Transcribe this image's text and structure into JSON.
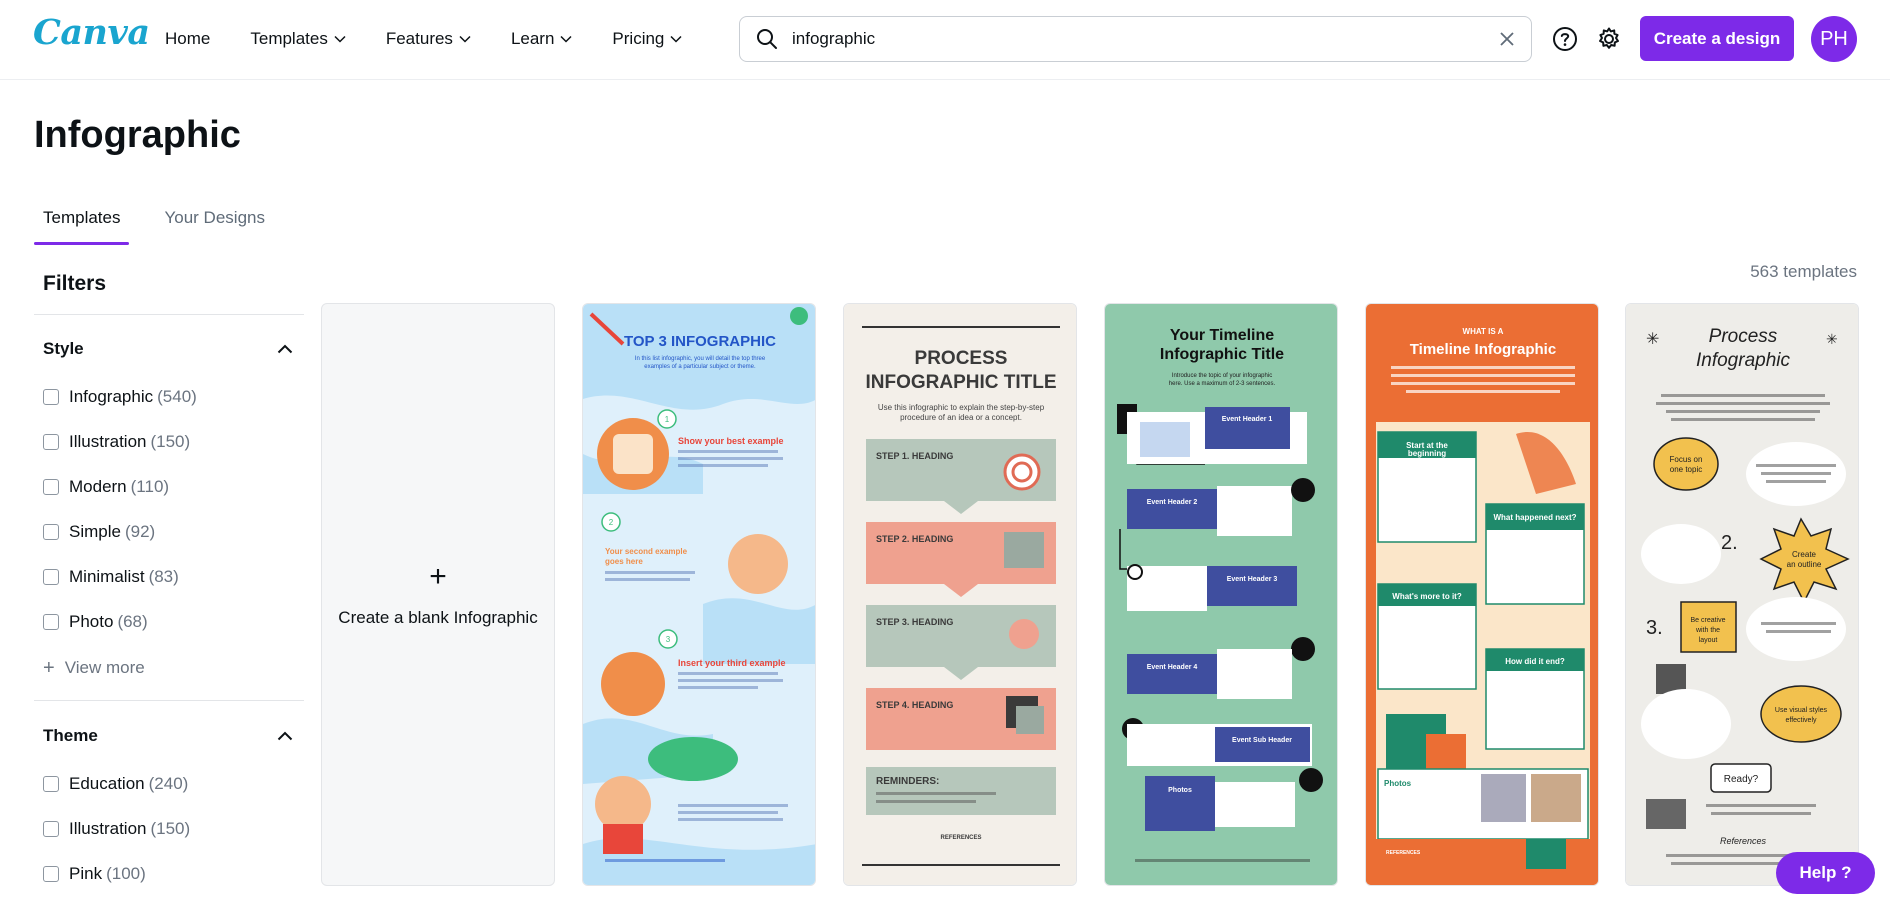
{
  "brand": {
    "logo_text": "Canva",
    "accent": "#7d2ae8",
    "logo_color": "#1aa5cf"
  },
  "nav": {
    "items": [
      {
        "label": "Home",
        "has_menu": false
      },
      {
        "label": "Templates",
        "has_menu": true
      },
      {
        "label": "Features",
        "has_menu": true
      },
      {
        "label": "Learn",
        "has_menu": true
      },
      {
        "label": "Pricing",
        "has_menu": true
      }
    ]
  },
  "search": {
    "value": "infographic",
    "icon": "search-icon",
    "clear_icon": "close-icon"
  },
  "header_actions": {
    "help_icon": "question-circle-icon",
    "settings_icon": "gear-icon",
    "create_label": "Create a design",
    "avatar_initials": "PH"
  },
  "page": {
    "title": "Infographic",
    "tabs": [
      {
        "label": "Templates",
        "active": true
      },
      {
        "label": "Your Designs",
        "active": false
      }
    ],
    "template_count": "563 templates"
  },
  "filters": {
    "title": "Filters",
    "style": {
      "title": "Style",
      "options": [
        {
          "label": "Infographic",
          "count": "(540)"
        },
        {
          "label": "Illustration",
          "count": "(150)"
        },
        {
          "label": "Modern",
          "count": "(110)"
        },
        {
          "label": "Simple",
          "count": "(92)"
        },
        {
          "label": "Minimalist",
          "count": "(83)"
        },
        {
          "label": "Photo",
          "count": "(68)"
        }
      ],
      "view_more": "View more"
    },
    "theme": {
      "title": "Theme",
      "options": [
        {
          "label": "Education",
          "count": "(240)"
        },
        {
          "label": "Illustration",
          "count": "(150)"
        },
        {
          "label": "Pink",
          "count": "(100)"
        }
      ]
    }
  },
  "blank_card": {
    "label": "Create a blank Infographic"
  },
  "templates": [
    {
      "name": "top-3-infographic",
      "title": "TOP 3 INFOGRAPHIC",
      "subtitle": "In this list infographic, you will detail the top three examples of a particular subject or theme.",
      "items": [
        "Show your best example",
        "Your second example goes here",
        "Insert your third example"
      ]
    },
    {
      "name": "process-infographic-title",
      "title": "PROCESS INFOGRAPHIC TITLE",
      "subtitle": "Use this infographic to explain the step-by-step procedure of an idea or a concept.",
      "steps": [
        "STEP 1. HEADING",
        "STEP 2. HEADING",
        "STEP 3. HEADING",
        "STEP 4. HEADING"
      ],
      "reminders": "REMINDERS:",
      "references": "REFERENCES"
    },
    {
      "name": "your-timeline-infographic-title",
      "title": "Your Timeline Infographic Title",
      "subtitle": "Introduce the topic of your infographic here. Use a maximum of 2-3 sentences.",
      "events": [
        "Event Header 1",
        "Event Header 2",
        "Event Header 3",
        "Event Header 4",
        "Event Sub Header",
        "Photos"
      ]
    },
    {
      "name": "what-is-a-timeline-infographic",
      "kicker": "WHAT IS A",
      "title": "Timeline Infographic",
      "subtitle": "A timeline infographic highlights important events related to the topic in a short and visualized manner.",
      "boxes": [
        "Start at the beginning",
        "What happened next?",
        "What's more to it?",
        "How did it end?",
        "Photos"
      ],
      "references": "REFERENCES"
    },
    {
      "name": "process-infographic",
      "title": "Process Infographic",
      "subtitle": "Do you need to present a complex idea or process in an easy-to-understand manner?",
      "bubbles": [
        "Focus on one topic",
        "Create an outline",
        "Be creative with the layout",
        "Use visual styles effectively",
        "Ready?"
      ],
      "references": "References"
    }
  ],
  "help": {
    "label": "Help ?"
  }
}
